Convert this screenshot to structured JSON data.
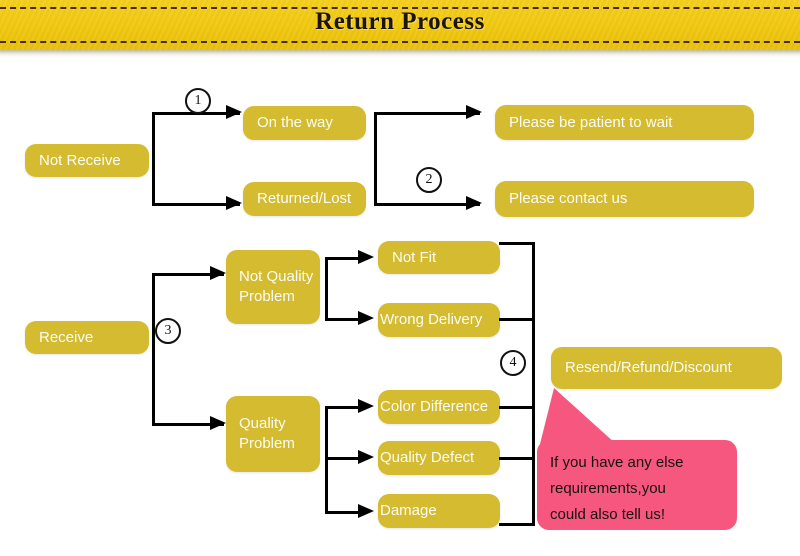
{
  "header": {
    "title": "Return Process"
  },
  "flow": {
    "roots": [
      {
        "id": "not-receive",
        "label": "Not Receive"
      },
      {
        "id": "receive",
        "label": "Receive"
      }
    ],
    "steps": [
      {
        "id": "step-1",
        "label": "1"
      },
      {
        "id": "step-2",
        "label": "2"
      },
      {
        "id": "step-3",
        "label": "3"
      },
      {
        "id": "step-4",
        "label": "4"
      }
    ],
    "not_receive_branch": {
      "conditions": [
        {
          "id": "on-the-way",
          "label": "On the way"
        },
        {
          "id": "returned-lost",
          "label": "Returned/Lost"
        }
      ],
      "outcomes": [
        {
          "id": "be-patient",
          "label": "Please be patient to wait"
        },
        {
          "id": "contact-us",
          "label": "Please contact us"
        }
      ]
    },
    "receive_branch": {
      "categories": [
        {
          "id": "not-quality-problem",
          "label": "Not Quality Problem"
        },
        {
          "id": "quality-problem",
          "label": "Quality Problem"
        }
      ],
      "not_quality_reasons": [
        {
          "id": "not-fit",
          "label": "Not Fit"
        },
        {
          "id": "wrong-delivery",
          "label": "Wrong Delivery"
        }
      ],
      "quality_reasons": [
        {
          "id": "color-difference",
          "label": "Color Difference"
        },
        {
          "id": "quality-defect",
          "label": "Quality Defect"
        },
        {
          "id": "damage",
          "label": "Damage"
        }
      ],
      "resolution": {
        "id": "resend-refund-discount",
        "label": "Resend/Refund/Discount"
      }
    }
  },
  "callout": {
    "line1": "If you have any else",
    "line2": "requirements,you",
    "line3": "could also tell us!"
  },
  "colors": {
    "banner": "#f0c911",
    "node": "#d4bb2f",
    "node_text": "#fdfcf4",
    "callout": "#f5577f",
    "connector": "#000000"
  }
}
